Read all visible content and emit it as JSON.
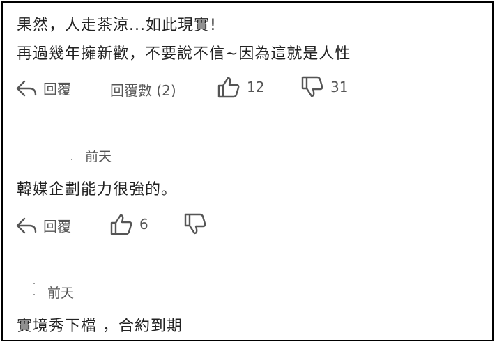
{
  "comments": [
    {
      "lines": [
        "果然，人走茶涼...如此現實!",
        "再過幾年擁新歡，不要說不信~因為這就是人性"
      ],
      "reply_label": "回覆",
      "replies_label": "回覆數 (2)",
      "likes": "12",
      "dislikes": "31"
    },
    {
      "time": "前天",
      "lines": [
        "韓媒企劃能力很強的。"
      ],
      "reply_label": "回覆",
      "likes": "6"
    },
    {
      "time": "前天",
      "lines": [
        "實境秀下檔 ，合約到期"
      ]
    }
  ]
}
